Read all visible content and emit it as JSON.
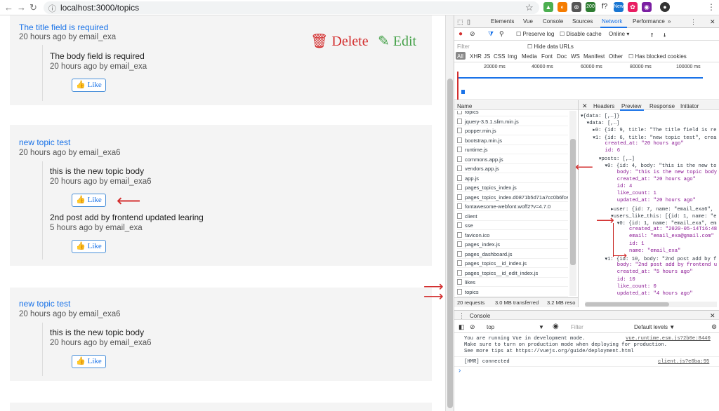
{
  "browser": {
    "url": "localhost:3000/topics",
    "back": "←",
    "forward": "→",
    "reload": "↻",
    "lock": "ⓘ",
    "star": "☆",
    "ext_labels": [
      "▲",
      "◐",
      "⊛",
      "200",
      "f?",
      "New",
      "✿",
      "◉",
      "●",
      "⋮"
    ]
  },
  "page": {
    "delete_label": "Delete",
    "edit_label": "Edit",
    "like_label": "Like",
    "topics": [
      {
        "title": "The title field is required",
        "meta": "20 hours ago by email_exa",
        "posts": [
          {
            "body": "The body field is required",
            "meta": "20 hours ago by email_exa"
          }
        ]
      },
      {
        "title": "new topic test",
        "meta": "20 hours ago by email_exa6",
        "posts": [
          {
            "body": "this is the new topic body",
            "meta": "20 hours ago by email_exa6"
          },
          {
            "body": "2nd post add by frontend updated learing",
            "meta": "5 hours ago by email_exa"
          }
        ]
      },
      {
        "title": "new topic test",
        "meta": "20 hours ago by email_exa6",
        "posts": [
          {
            "body": "this is the new topic body",
            "meta": "20 hours ago by email_exa6"
          }
        ]
      }
    ]
  },
  "devtools": {
    "tabs": [
      "Elements",
      "Vue",
      "Console",
      "Sources",
      "Network",
      "Performance"
    ],
    "active_tab": "Network",
    "toolbar": {
      "preserve_log": "Preserve log",
      "disable_cache": "Disable cache",
      "online": "Online",
      "filter_placeholder": "Filter",
      "hide_data_urls": "Hide data URLs"
    },
    "types": [
      "All",
      "XHR",
      "JS",
      "CSS",
      "Img",
      "Media",
      "Font",
      "Doc",
      "WS",
      "Manifest",
      "Other"
    ],
    "blocked_cookies": "Has blocked cookies",
    "timeline": [
      "20000 ms",
      "40000 ms",
      "60000 ms",
      "80000 ms",
      "100000 ms"
    ],
    "name_header": "Name",
    "requests": [
      "topics",
      "jquery-3.5.1.slim.min.js",
      "popper.min.js",
      "bootstrap.min.js",
      "runtime.js",
      "commons.app.js",
      "vendors.app.js",
      "app.js",
      "pages_topics_index.js",
      "pages_topics_index.d0871b5d71a7cc0b6fce",
      "fontawesome-webfont.woff2?v=4.7.0",
      "client",
      "sse",
      "favicon.ico",
      "pages_index.js",
      "pages_dashboard.js",
      "pages_topics__id_index.js",
      "pages_topics__id_edit_index.js",
      "likes",
      "topics"
    ],
    "status": {
      "requests": "20 requests",
      "transferred": "3.0 MB transferred",
      "resources": "3.2 MB reso"
    },
    "detail_tabs": [
      "Headers",
      "Preview",
      "Response",
      "Initiator"
    ],
    "active_detail": "Preview",
    "preview": [
      "▾{data: [,…]}",
      "  ▾data: [,…]",
      "    ▸0: {id: 9, title: \"The title field is re",
      "    ▾1: {id: 6, title: \"new topic test\", crea",
      "        created_at: \"20 hours ago\"",
      "        id: 6",
      "      ▾posts: [,…]",
      "        ▾0: {id: 4, body: \"this is the new to",
      "            body: \"this is the new topic body\"",
      "            created_at: \"20 hours ago\"",
      "            id: 4",
      "            like_count: 1",
      "            updated_at: \"20 hours ago\"",
      "          ▸user: {id: 7, name: \"email_exa6\",",
      "          ▾users_like_this: [{id: 1, name: \"e",
      "            ▾0: {id: 1, name: \"email_exa\", em",
      "                created_at: \"2020-05-14T16:48:1",
      "                email: \"email_exa@gmail.com\"",
      "                id: 1",
      "                name: \"email_exa\"",
      "        ▾1: {id: 10, body: \"2nd post add by f",
      "            body: \"2nd post add by frontend up",
      "            created_at: \"5 hours ago\"",
      "            id: 10",
      "            like_count: 0",
      "            updated_at: \"4 hours ago\""
    ],
    "console": {
      "tab": "Console",
      "context": "top",
      "filter": "Filter",
      "levels": "Default levels ▼",
      "lines": [
        {
          "text": "You are running Vue in development mode.",
          "src": "vue.runtime.esm.js?2b0e:8440"
        },
        {
          "text": "Make sure to turn on production mode when deploying for production.",
          "src": ""
        },
        {
          "text": "See more tips at https://vuejs.org/guide/deployment.html",
          "src": ""
        },
        {
          "text": "[HMR] connected",
          "src": "client.js?e0ba:95"
        }
      ],
      "prompt": "›"
    }
  }
}
